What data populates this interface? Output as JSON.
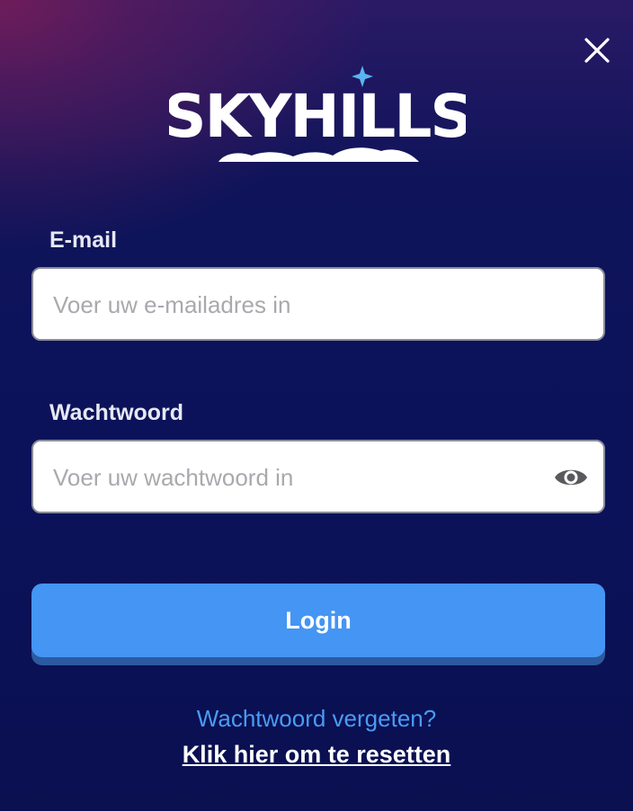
{
  "dialog": {
    "logo_text": "SKYHILLS",
    "close_icon": "close-icon"
  },
  "form": {
    "email_label": "E-mail",
    "email_placeholder": "Voer uw e-mailadres in",
    "email_value": "",
    "password_label": "Wachtwoord",
    "password_placeholder": "Voer uw wachtwoord in",
    "password_value": "",
    "password_toggle_icon": "eye-icon",
    "login_label": "Login"
  },
  "footer": {
    "forgot_text": "Wachtwoord vergeten?",
    "reset_link": "Klik hier om te resetten"
  },
  "colors": {
    "accent": "#4495f4",
    "link": "#4a9bf2",
    "background": "#0b125a"
  }
}
